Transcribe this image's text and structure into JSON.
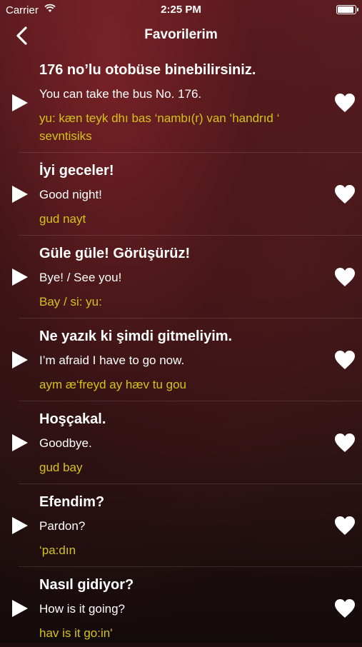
{
  "status": {
    "carrier": "Carrier",
    "time": "2:25 PM",
    "battery_level": 1.0
  },
  "nav": {
    "title": "Favorilerim",
    "back_icon": "chevron-left-icon"
  },
  "items": [
    {
      "turkish": "176 no’lu otobüse binebilirsiniz.",
      "english": "You can take the bus No. 176.",
      "pronunciation": "yu: kæn teyk dhı bas ‘nambı(r) van ‘handrıd ‘ sevntisiks"
    },
    {
      "turkish": "İyi geceler!",
      "english": "Good night!",
      "pronunciation": "gud nayt"
    },
    {
      "turkish": "Güle güle! Görüşürüz!",
      "english": "Bye! / See you!",
      "pronunciation": "Bay / si: yu:"
    },
    {
      "turkish": "Ne yazık ki şimdi gitmeliyim.",
      "english": "I’m afraid I have to go now.",
      "pronunciation": "aym æ‘freyd ay hæv tu gou"
    },
    {
      "turkish": "Hoşçakal.",
      "english": "Goodbye.",
      "pronunciation": "gud bay"
    },
    {
      "turkish": "Efendim?",
      "english": "Pardon?",
      "pronunciation": "‘pa:dın"
    },
    {
      "turkish": "Nasıl gidiyor?",
      "english": "How is it going?",
      "pronunciation": "hav is it go:in'"
    }
  ],
  "colors": {
    "pronunciation": "#d4c21b",
    "text": "#ffffff"
  }
}
